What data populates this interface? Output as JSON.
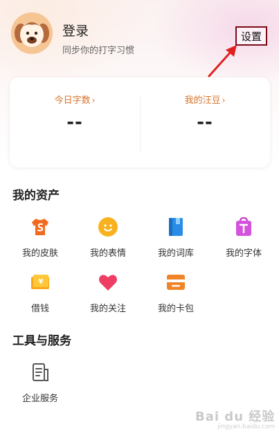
{
  "profile": {
    "title": "登录",
    "subtitle": "同步你的打字习惯",
    "settings_label": "设置"
  },
  "stats": {
    "today_label": "今日字数",
    "today_value": "--",
    "beans_label": "我的汪豆",
    "beans_value": "--",
    "chevron": "›"
  },
  "assets": {
    "title": "我的资产",
    "items": [
      {
        "label": "我的皮肤",
        "icon": "skin-shirt-icon"
      },
      {
        "label": "我的表情",
        "icon": "emoji-face-icon"
      },
      {
        "label": "我的词库",
        "icon": "dictionary-book-icon"
      },
      {
        "label": "我的字体",
        "icon": "font-bag-icon"
      },
      {
        "label": "借钱",
        "icon": "borrow-money-icon"
      },
      {
        "label": "我的关注",
        "icon": "heart-icon"
      },
      {
        "label": "我的卡包",
        "icon": "card-wallet-icon"
      }
    ]
  },
  "tools": {
    "title": "工具与服务",
    "items": [
      {
        "label": "企业服务",
        "icon": "enterprise-document-icon"
      }
    ]
  },
  "watermark": {
    "text": "Bai du 经验",
    "sub": "jingyan.baidu.com"
  },
  "colors": {
    "accent_orange": "#d9722a",
    "annotation_red": "#e02020",
    "annotation_box": "#7a0a18"
  }
}
